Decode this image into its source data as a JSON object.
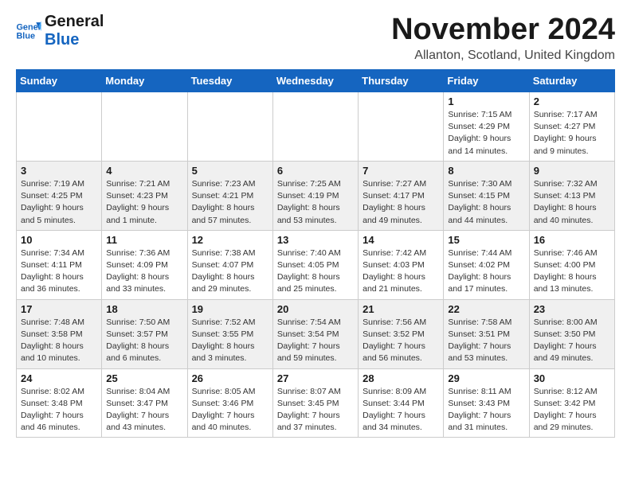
{
  "header": {
    "logo_line1": "General",
    "logo_line2": "Blue",
    "month_title": "November 2024",
    "location": "Allanton, Scotland, United Kingdom"
  },
  "weekdays": [
    "Sunday",
    "Monday",
    "Tuesday",
    "Wednesday",
    "Thursday",
    "Friday",
    "Saturday"
  ],
  "weeks": [
    [
      {
        "day": "",
        "info": ""
      },
      {
        "day": "",
        "info": ""
      },
      {
        "day": "",
        "info": ""
      },
      {
        "day": "",
        "info": ""
      },
      {
        "day": "",
        "info": ""
      },
      {
        "day": "1",
        "info": "Sunrise: 7:15 AM\nSunset: 4:29 PM\nDaylight: 9 hours\nand 14 minutes."
      },
      {
        "day": "2",
        "info": "Sunrise: 7:17 AM\nSunset: 4:27 PM\nDaylight: 9 hours\nand 9 minutes."
      }
    ],
    [
      {
        "day": "3",
        "info": "Sunrise: 7:19 AM\nSunset: 4:25 PM\nDaylight: 9 hours\nand 5 minutes."
      },
      {
        "day": "4",
        "info": "Sunrise: 7:21 AM\nSunset: 4:23 PM\nDaylight: 9 hours\nand 1 minute."
      },
      {
        "day": "5",
        "info": "Sunrise: 7:23 AM\nSunset: 4:21 PM\nDaylight: 8 hours\nand 57 minutes."
      },
      {
        "day": "6",
        "info": "Sunrise: 7:25 AM\nSunset: 4:19 PM\nDaylight: 8 hours\nand 53 minutes."
      },
      {
        "day": "7",
        "info": "Sunrise: 7:27 AM\nSunset: 4:17 PM\nDaylight: 8 hours\nand 49 minutes."
      },
      {
        "day": "8",
        "info": "Sunrise: 7:30 AM\nSunset: 4:15 PM\nDaylight: 8 hours\nand 44 minutes."
      },
      {
        "day": "9",
        "info": "Sunrise: 7:32 AM\nSunset: 4:13 PM\nDaylight: 8 hours\nand 40 minutes."
      }
    ],
    [
      {
        "day": "10",
        "info": "Sunrise: 7:34 AM\nSunset: 4:11 PM\nDaylight: 8 hours\nand 36 minutes."
      },
      {
        "day": "11",
        "info": "Sunrise: 7:36 AM\nSunset: 4:09 PM\nDaylight: 8 hours\nand 33 minutes."
      },
      {
        "day": "12",
        "info": "Sunrise: 7:38 AM\nSunset: 4:07 PM\nDaylight: 8 hours\nand 29 minutes."
      },
      {
        "day": "13",
        "info": "Sunrise: 7:40 AM\nSunset: 4:05 PM\nDaylight: 8 hours\nand 25 minutes."
      },
      {
        "day": "14",
        "info": "Sunrise: 7:42 AM\nSunset: 4:03 PM\nDaylight: 8 hours\nand 21 minutes."
      },
      {
        "day": "15",
        "info": "Sunrise: 7:44 AM\nSunset: 4:02 PM\nDaylight: 8 hours\nand 17 minutes."
      },
      {
        "day": "16",
        "info": "Sunrise: 7:46 AM\nSunset: 4:00 PM\nDaylight: 8 hours\nand 13 minutes."
      }
    ],
    [
      {
        "day": "17",
        "info": "Sunrise: 7:48 AM\nSunset: 3:58 PM\nDaylight: 8 hours\nand 10 minutes."
      },
      {
        "day": "18",
        "info": "Sunrise: 7:50 AM\nSunset: 3:57 PM\nDaylight: 8 hours\nand 6 minutes."
      },
      {
        "day": "19",
        "info": "Sunrise: 7:52 AM\nSunset: 3:55 PM\nDaylight: 8 hours\nand 3 minutes."
      },
      {
        "day": "20",
        "info": "Sunrise: 7:54 AM\nSunset: 3:54 PM\nDaylight: 7 hours\nand 59 minutes."
      },
      {
        "day": "21",
        "info": "Sunrise: 7:56 AM\nSunset: 3:52 PM\nDaylight: 7 hours\nand 56 minutes."
      },
      {
        "day": "22",
        "info": "Sunrise: 7:58 AM\nSunset: 3:51 PM\nDaylight: 7 hours\nand 53 minutes."
      },
      {
        "day": "23",
        "info": "Sunrise: 8:00 AM\nSunset: 3:50 PM\nDaylight: 7 hours\nand 49 minutes."
      }
    ],
    [
      {
        "day": "24",
        "info": "Sunrise: 8:02 AM\nSunset: 3:48 PM\nDaylight: 7 hours\nand 46 minutes."
      },
      {
        "day": "25",
        "info": "Sunrise: 8:04 AM\nSunset: 3:47 PM\nDaylight: 7 hours\nand 43 minutes."
      },
      {
        "day": "26",
        "info": "Sunrise: 8:05 AM\nSunset: 3:46 PM\nDaylight: 7 hours\nand 40 minutes."
      },
      {
        "day": "27",
        "info": "Sunrise: 8:07 AM\nSunset: 3:45 PM\nDaylight: 7 hours\nand 37 minutes."
      },
      {
        "day": "28",
        "info": "Sunrise: 8:09 AM\nSunset: 3:44 PM\nDaylight: 7 hours\nand 34 minutes."
      },
      {
        "day": "29",
        "info": "Sunrise: 8:11 AM\nSunset: 3:43 PM\nDaylight: 7 hours\nand 31 minutes."
      },
      {
        "day": "30",
        "info": "Sunrise: 8:12 AM\nSunset: 3:42 PM\nDaylight: 7 hours\nand 29 minutes."
      }
    ]
  ]
}
